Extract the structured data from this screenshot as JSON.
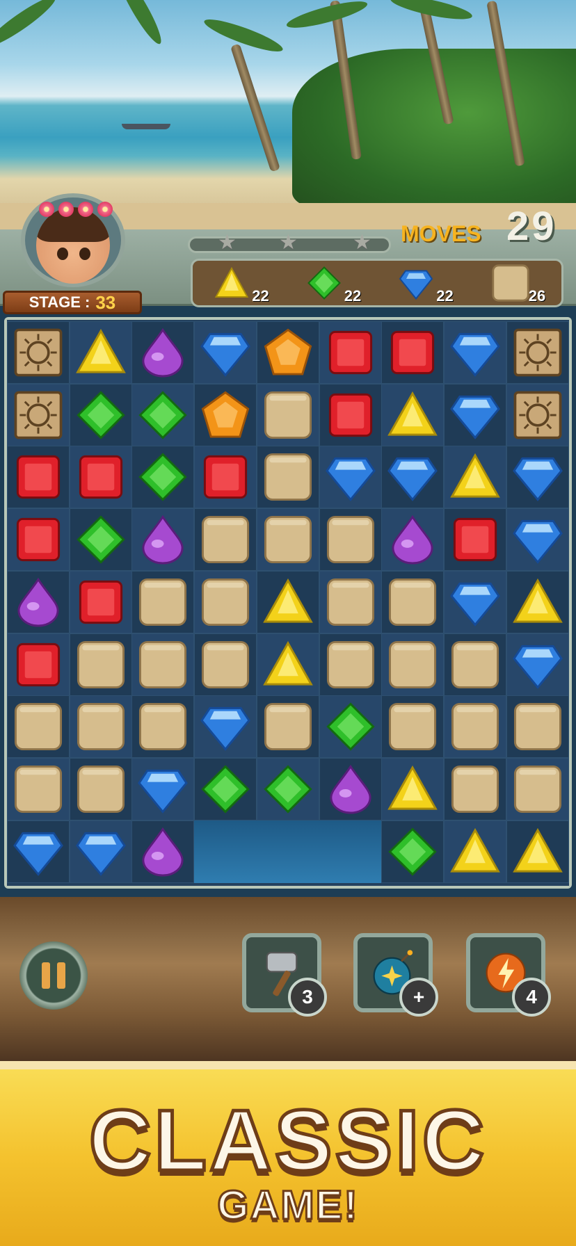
{
  "hud": {
    "stage_label": "STAGE :",
    "stage_number": "33",
    "moves_label": "MOVES",
    "moves_value": "29",
    "stars_earned": 0,
    "stars_total": 3
  },
  "goals": [
    {
      "gem": "yellow-triangle",
      "count": "22"
    },
    {
      "gem": "green-diamond",
      "count": "22"
    },
    {
      "gem": "blue-diamond",
      "count": "22"
    },
    {
      "gem": "sand-block",
      "count": "26"
    }
  ],
  "board": {
    "rows": [
      [
        "carved",
        "Y",
        "P",
        "B",
        "O",
        "R",
        "R",
        "B",
        "carved"
      ],
      [
        "carved",
        "G",
        "G",
        "O",
        "S",
        "R",
        "Y",
        "B",
        "carved"
      ],
      [
        "R",
        "R",
        "G",
        "R",
        "S",
        "B",
        "B",
        "Y",
        "B"
      ],
      [
        "R",
        "G",
        "P",
        "S",
        "S",
        "S",
        "P",
        "R",
        "B"
      ],
      [
        "P",
        "R",
        "S",
        "S",
        "Y",
        "S",
        "S",
        "B",
        "Y"
      ],
      [
        "R",
        "S",
        "S",
        "S",
        "Y",
        "S",
        "S",
        "S",
        "B"
      ],
      [
        "S",
        "S",
        "S",
        "B",
        "S",
        "G",
        "S",
        "S",
        "S"
      ],
      [
        "S",
        "S",
        "B",
        "G",
        "G",
        "P",
        "Y",
        "S",
        "S"
      ],
      [
        "B",
        "B",
        "P",
        "x",
        "x",
        "x",
        "G",
        "Y",
        "Y"
      ]
    ]
  },
  "boosters": [
    {
      "name": "hammer",
      "count": "3"
    },
    {
      "name": "bomb",
      "count": "+"
    },
    {
      "name": "lightning",
      "count": "4"
    }
  ],
  "banner": {
    "line1": "CLASSIC",
    "line2": "GAME!"
  },
  "colors": {
    "R": "#e0202a",
    "G": "#2fbf2a",
    "B": "#2f7fe0",
    "Y": "#f3d21a",
    "P": "#a64ad0",
    "O": "#f39418",
    "S": "#d6bd8d"
  }
}
